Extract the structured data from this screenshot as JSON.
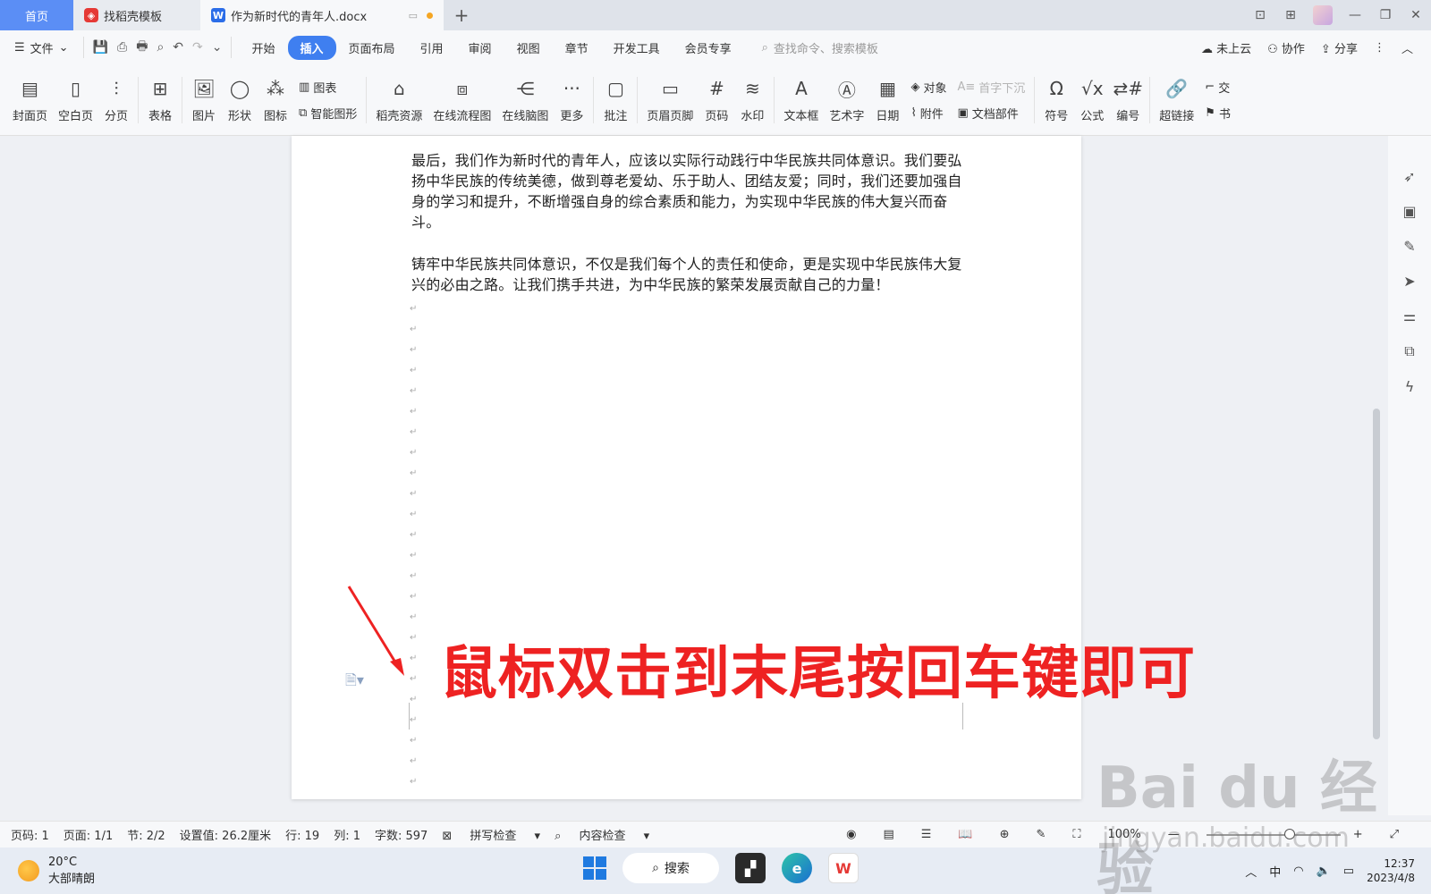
{
  "tabs": {
    "home": "首页",
    "templates": "找稻壳模板",
    "document": "作为新时代的青年人.docx"
  },
  "menubar": {
    "file": "文件",
    "tabs": [
      "开始",
      "插入",
      "页面布局",
      "引用",
      "审阅",
      "视图",
      "章节",
      "开发工具",
      "会员专享"
    ],
    "active_tab": "插入",
    "search_placeholder": "查找命令、搜索模板",
    "cloud": "未上云",
    "collab": "协作",
    "share": "分享"
  },
  "ribbon": {
    "cover": "封面页",
    "blank": "空白页",
    "pagebreak": "分页",
    "table": "表格",
    "picture": "图片",
    "shape": "形状",
    "icon": "图标",
    "chart": "图表",
    "smart": "智能图形",
    "resources": "稻壳资源",
    "flowchart": "在线流程图",
    "mindmap": "在线脑图",
    "more": "更多",
    "comment": "批注",
    "header_footer": "页眉页脚",
    "page_number": "页码",
    "watermark": "水印",
    "textbox": "文本框",
    "wordart": "艺术字",
    "date": "日期",
    "object": "对象",
    "dropcap": "首字下沉",
    "attachment": "附件",
    "doc_parts": "文档部件",
    "symbol": "符号",
    "formula": "公式",
    "numbering": "编号",
    "hyperlink": "超链接",
    "cross": "交",
    "bookmark": "书"
  },
  "document": {
    "para1": "最后，我们作为新时代的青年人，应该以实际行动践行中华民族共同体意识。我们要弘扬中华民族的传统美德，做到尊老爱幼、乐于助人、团结友爱；同时，我们还要加强自身的学习和提升，不断增强自身的综合素质和能力，为实现中华民族的伟大复兴而奋斗。",
    "para2": "铸牢中华民族共同体意识，不仅是我们每个人的责任和使命，更是实现中华民族伟大复兴的必由之路。让我们携手共进，为中华民族的繁荣发展贡献自己的力量！",
    "annotation": "鼠标双击到末尾按回车键即可"
  },
  "status": {
    "page_code": "页码: 1",
    "pages": "页面: 1/1",
    "section": "节: 2/2",
    "setting": "设置值: 26.2厘米",
    "row": "行: 19",
    "col": "列: 1",
    "words": "字数: 597",
    "spell": "拼写检查",
    "content": "内容检查",
    "zoom": "100%",
    "zoom_level": 0.62
  },
  "taskbar": {
    "temp": "20°C",
    "weather": "大部晴朗",
    "search": "搜索",
    "ime": "中",
    "time": "12:37",
    "date": "2023/4/8"
  },
  "watermark": {
    "brand": "Bai du 经验",
    "url": "jingyan.baidu.com"
  }
}
